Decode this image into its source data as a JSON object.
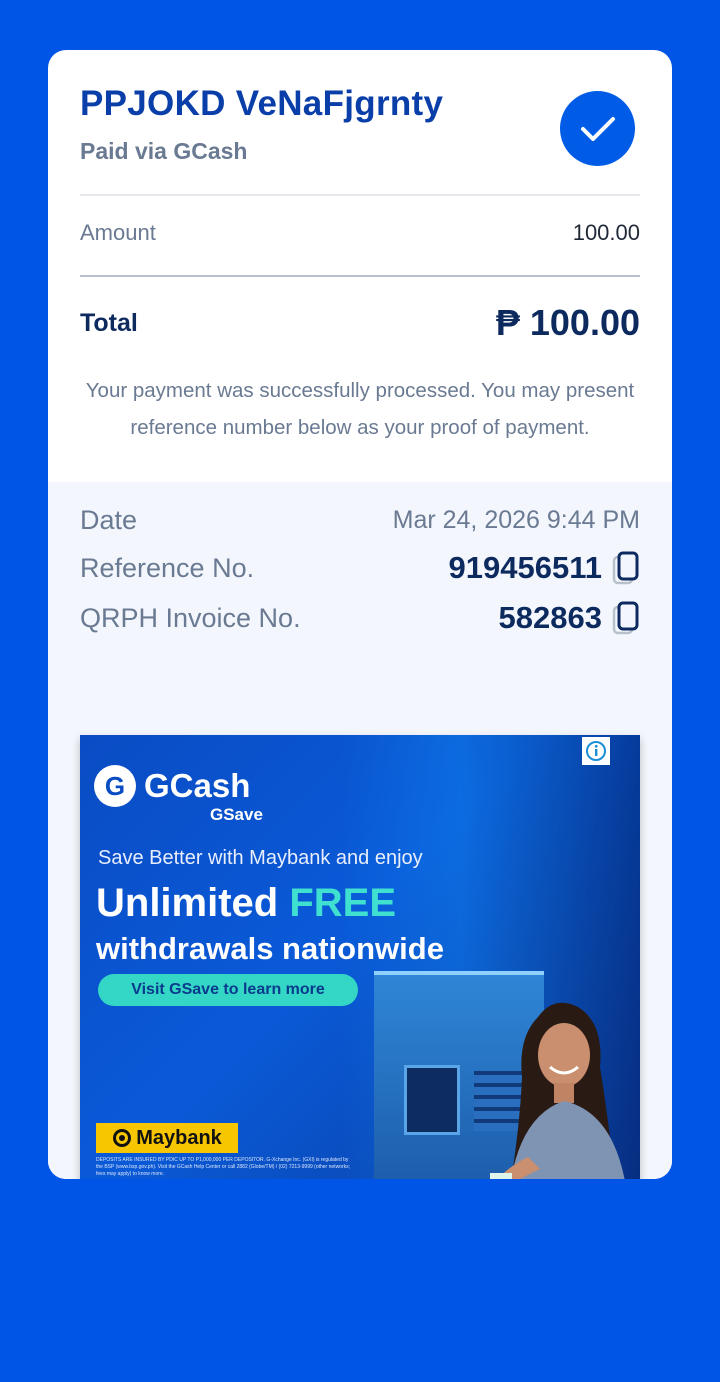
{
  "receipt": {
    "merchant": "PPJOKD VeNaFjgrnty",
    "paid_via": "Paid via GCash",
    "amount_label": "Amount",
    "amount_value": "100.00",
    "total_label": "Total",
    "total_value": "₱ 100.00",
    "message": "Your payment was successfully processed. You may present reference number below as your proof of payment."
  },
  "details": {
    "date_label": "Date",
    "date_value": "Mar 24, 2026 9:44 PM",
    "ref_label": "Reference No.",
    "ref_value": "919456511",
    "invoice_label": "QRPH Invoice No.",
    "invoice_value": "582863"
  },
  "ad": {
    "brand": "GCash",
    "sub_brand": "GSave",
    "line1": "Save Better with Maybank and enjoy",
    "line2_a": "Unlimited ",
    "line2_b": "FREE",
    "line3": "withdrawals nationwide",
    "cta": "Visit GSave to learn more",
    "partner": "Maybank",
    "fine_print": "DEPOSITS ARE INSURED BY PDIC UP TO P1,000,000 PER DEPOSITOR. G-Xchange Inc. (GXI) is regulated by the BSP (www.bsp.gov.ph). Visit the GCash Help Center or call 2882 (Globe/TM) / (02) 7213-9999 (other networks; fees may apply) to know more."
  },
  "colors": {
    "background": "#0054e6",
    "brand_blue": "#005ce6",
    "title_blue": "#0a3ea8",
    "dark_navy": "#0d2a5e",
    "muted_gray": "#6a7a92"
  },
  "icons": [
    "checkmark-icon",
    "copy-icon",
    "info-icon"
  ]
}
